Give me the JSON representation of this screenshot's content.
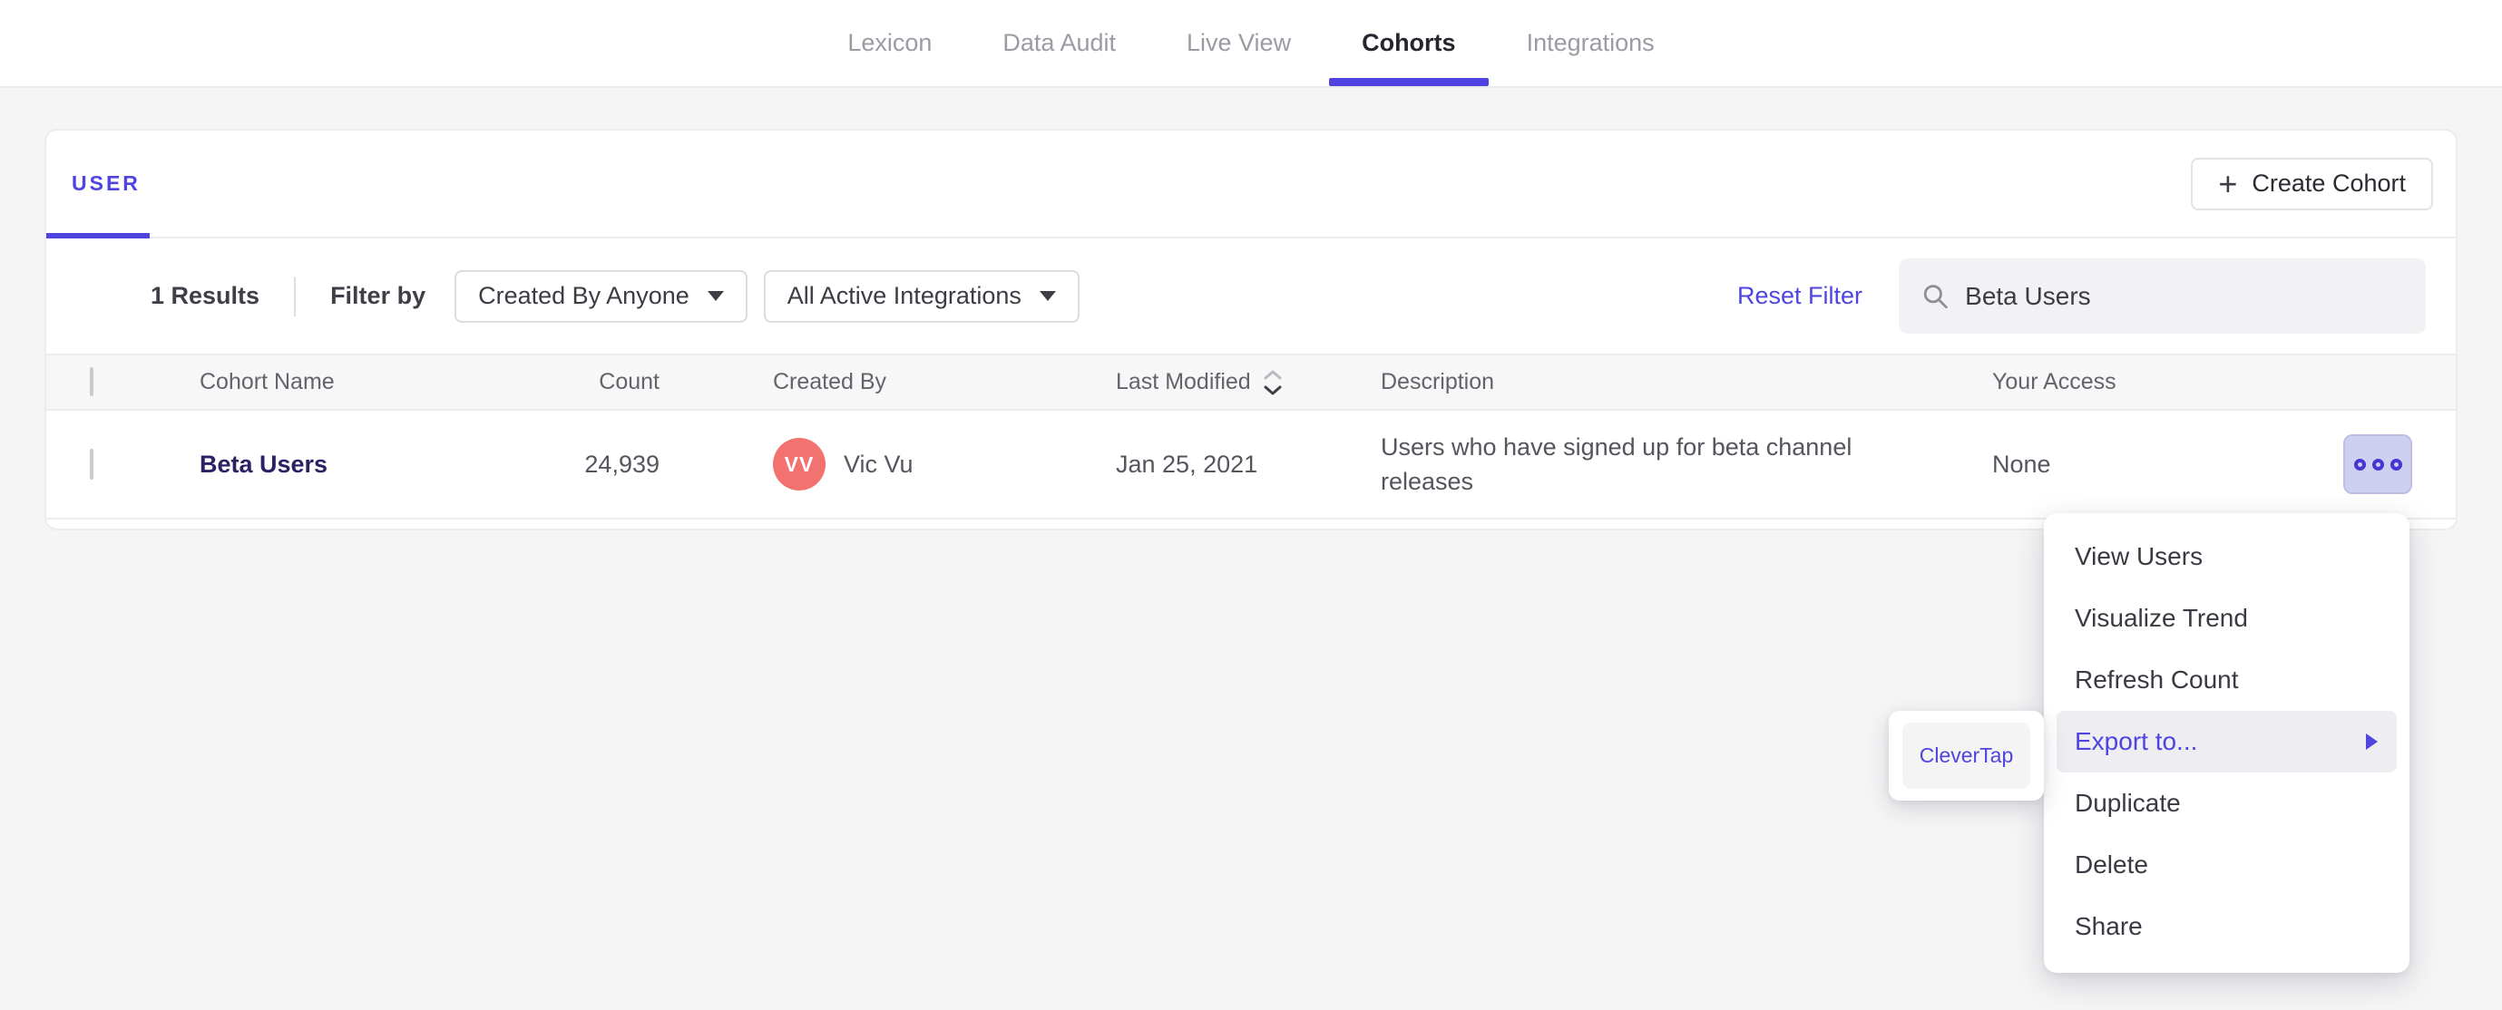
{
  "nav": {
    "tabs": [
      {
        "label": "Lexicon",
        "active": false
      },
      {
        "label": "Data Audit",
        "active": false
      },
      {
        "label": "Live View",
        "active": false
      },
      {
        "label": "Cohorts",
        "active": true
      },
      {
        "label": "Integrations",
        "active": false
      }
    ]
  },
  "card": {
    "tab_label": "USER",
    "create_button": {
      "label": "Create Cohort",
      "icon": "plus-icon",
      "plus_glyph": "+"
    },
    "filter_bar": {
      "results_count": "1 Results",
      "filter_by_label": "Filter by",
      "dropdowns": [
        {
          "label": "Created By Anyone"
        },
        {
          "label": "All Active Integrations"
        }
      ],
      "reset_label": "Reset Filter",
      "search": {
        "value": "Beta Users",
        "icon": "search-icon"
      }
    },
    "table": {
      "headers": [
        "Cohort Name",
        "Count",
        "Created By",
        "Last Modified",
        "Description",
        "Your Access"
      ],
      "sorted_column": "Last Modified",
      "rows": [
        {
          "name": "Beta Users",
          "count": "24,939",
          "creator_initials": "VV",
          "creator": "Vic Vu",
          "last_modified": "Jan 25, 2021",
          "description": "Users who have signed up for beta channel releases",
          "access": "None"
        }
      ]
    }
  },
  "context_menu": {
    "items": [
      {
        "label": "View Users",
        "highlighted": false
      },
      {
        "label": "Visualize Trend",
        "highlighted": false
      },
      {
        "label": "Refresh Count",
        "highlighted": false
      },
      {
        "label": "Export to...",
        "highlighted": true,
        "has_submenu": true
      },
      {
        "label": "Duplicate",
        "highlighted": false
      },
      {
        "label": "Delete",
        "highlighted": false
      },
      {
        "label": "Share",
        "highlighted": false
      }
    ]
  },
  "submenu": {
    "items": [
      {
        "label": "CleverTap"
      }
    ]
  },
  "colors": {
    "accent": "#4f44e0",
    "avatar": "#f2726f",
    "cohort_link": "#2b2264",
    "menu_highlight": "#ededf2",
    "ooo_button_bg": "#cfcff1",
    "page_bg": "#f5f5f6"
  }
}
